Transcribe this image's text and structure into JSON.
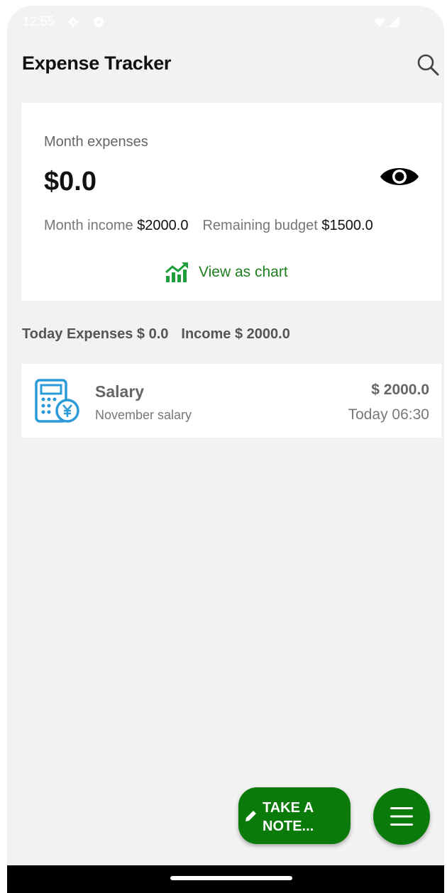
{
  "status_bar": {
    "time": "12:55",
    "icons": [
      "gear-icon",
      "shield-icon",
      "wifi-icon",
      "signal-icon"
    ]
  },
  "app_bar": {
    "title": "Expense Tracker",
    "search_icon": "search-icon"
  },
  "summary": {
    "label": "Month expenses",
    "amount": "$0.0",
    "visibility_icon": "eye-icon",
    "income_label": "Month income",
    "income_value": "$2000.0",
    "budget_label": "Remaining budget",
    "budget_value": "$1500.0",
    "chart_link": "View as chart",
    "chart_icon": "trending-chart-icon"
  },
  "today": {
    "expenses_label": "Today Expenses $ 0.0",
    "income_label": "Income $ 2000.0"
  },
  "transactions": [
    {
      "icon": "calculator-yen-icon",
      "title": "Salary",
      "note": "November salary",
      "amount": "$ 2000.0",
      "time": "Today 06:30"
    }
  ],
  "fab": {
    "note_label": "TAKE A NOTE...",
    "note_icon": "pencil-icon",
    "menu_icon": "menu-icon"
  },
  "colors": {
    "accent": "#0a7a0a",
    "chart_link": "#1e7f1e",
    "icon_blue": "#2a9ad8",
    "background": "#f2f2f2"
  }
}
